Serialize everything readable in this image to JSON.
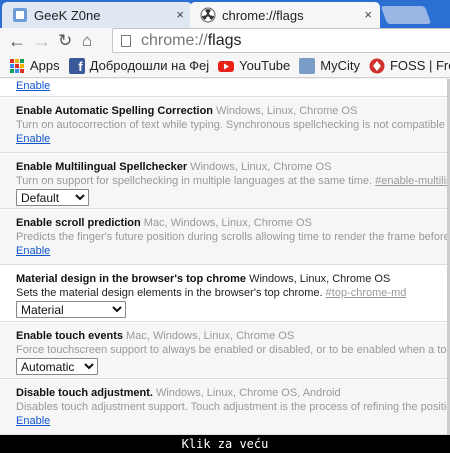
{
  "tabs": [
    {
      "title": "GeeK Z0ne",
      "close": "×"
    },
    {
      "title": "chrome://flags",
      "close": "×"
    }
  ],
  "toolbar": {
    "back": "←",
    "forward": "→",
    "reload": "↻",
    "home": "⌂",
    "url_scheme": "chrome://",
    "url_host": "flags"
  },
  "bookmarks": [
    {
      "label": "Apps",
      "icon": "apps-grid-icon",
      "color": "#d93025"
    },
    {
      "label": "Добродошли на Феј",
      "icon": "facebook-icon",
      "color": "#3b5998"
    },
    {
      "label": "YouTube",
      "icon": "youtube-icon",
      "color": "#e62117"
    },
    {
      "label": "MyCity",
      "icon": "mycity-icon",
      "color": "#7a9cc6"
    },
    {
      "label": "FOSS | Free and",
      "icon": "foss-icon",
      "color": "#d0312d"
    }
  ],
  "experiments": [
    {
      "top_link": "Enable"
    },
    {
      "title": "Enable Automatic Spelling Correction",
      "platforms": "Windows, Linux, Chrome OS",
      "desc": "Turn on autocorrection of text while typing. Synchronous spellchecking is not compatible with",
      "control": "Enable"
    },
    {
      "title": "Enable Multilingual Spellchecker",
      "platforms": "Windows, Linux, Chrome OS",
      "desc": "Turn on support for spellchecking in multiple languages at the same time.",
      "tag": "#enable-multiling",
      "control": "Default"
    },
    {
      "title": "Enable scroll prediction",
      "platforms": "Mac, Windows, Linux, Chrome OS",
      "desc": "Predicts the finger's future position during scrolls allowing time to render the frame before t",
      "control": "Enable"
    },
    {
      "title": "Material design in the browser's top chrome",
      "platforms": "Windows, Linux, Chrome OS",
      "desc": "Sets the material design elements in the browser's top chrome.",
      "tag": "#top-chrome-md",
      "control": "Material"
    },
    {
      "title": "Enable touch events",
      "platforms": "Mac, Windows, Linux, Chrome OS",
      "desc": "Force touchscreen support to always be enabled or disabled, or to be enabled when a touchs",
      "control": "Automatic"
    },
    {
      "title": "Disable touch adjustment.",
      "platforms": "Windows, Linux, Chrome OS, Android",
      "desc": "Disables touch adjustment support. Touch adjustment is the process of refining the position",
      "control": "Enable"
    }
  ],
  "caption": "Klik za veću"
}
